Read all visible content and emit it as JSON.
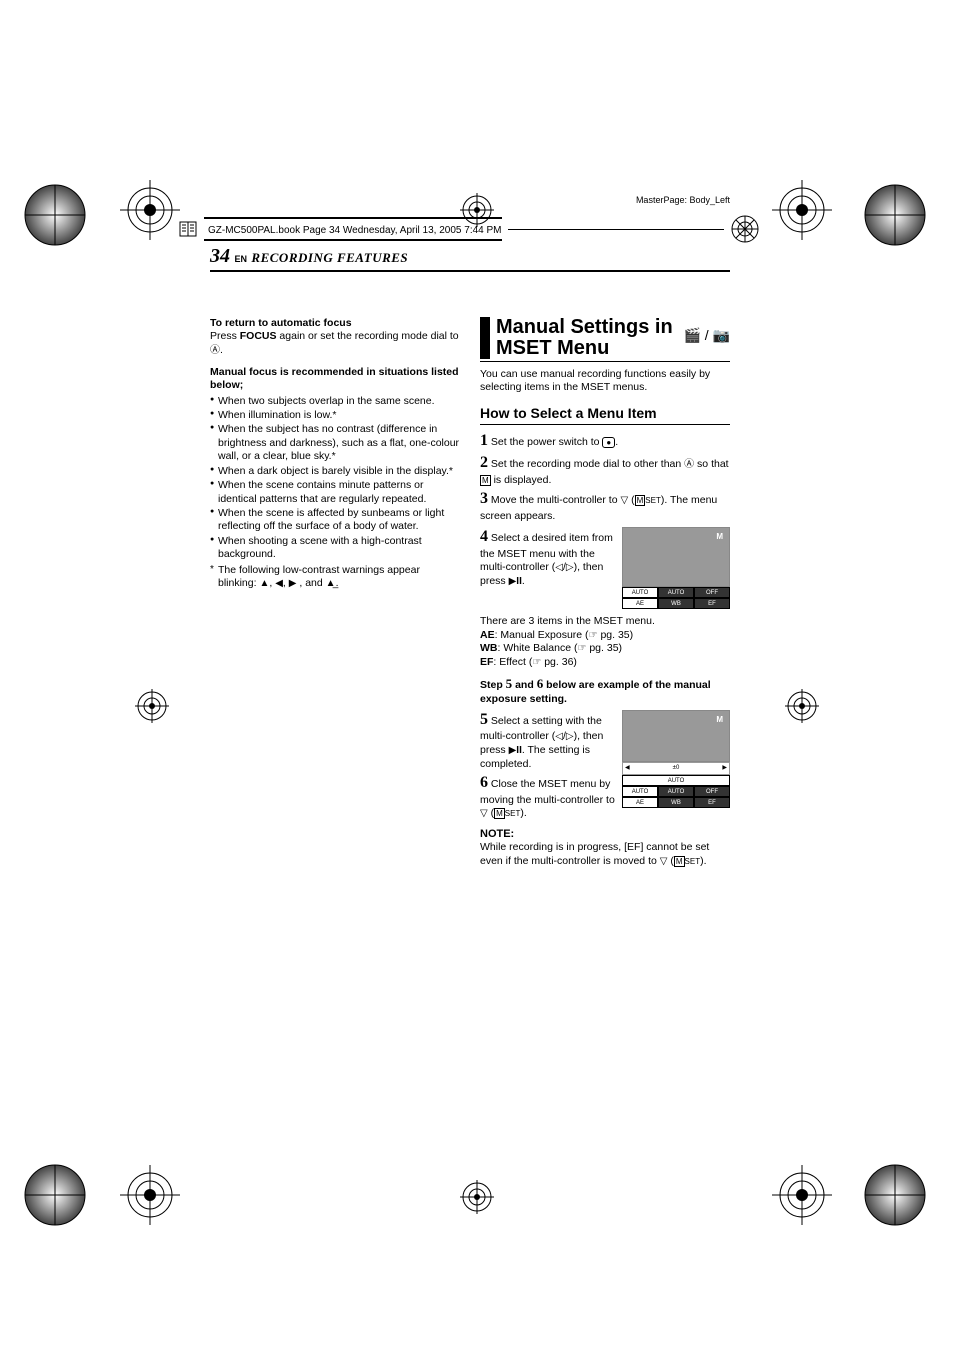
{
  "masterpage": "MasterPage: Body_Left",
  "book_ref": "GZ-MC500PAL.book  Page 34  Wednesday, April 13, 2005  7:44 PM",
  "page_number": "34",
  "en_label": "EN",
  "section_header": "RECORDING FEATURES",
  "left": {
    "return_hdr": "To return to automatic focus",
    "return_body_a": "Press ",
    "return_body_b": "FOCUS",
    "return_body_c": " again or set the recording mode dial to ",
    "return_body_d": ".",
    "rec_hdr": "Manual focus is recommended in situations listed below;",
    "bullets": [
      "When two subjects overlap in the same scene.",
      "When illumination is low.*",
      "When the subject has no contrast (difference in brightness and darkness), such as a flat, one-colour wall, or a clear, blue sky.*",
      "When a dark object is barely visible in the display.*",
      "When the scene contains minute patterns or identical patterns that are regularly repeated.",
      "When the scene is affected by sunbeams or light reflecting off the surface of a body of water.",
      "When shooting a scene with a high-contrast background."
    ],
    "star_note_a": "The following low-contrast warnings appear blinking: ",
    "star_note_b": ", and ",
    "star_note_c": "."
  },
  "right": {
    "title": "Manual Settings in MSET Menu",
    "intro": "You can use manual recording functions easily by selecting items in the MSET menus.",
    "howto": "How to Select a Menu Item",
    "step1": "Set the power switch to ",
    "step1_end": ".",
    "step2a": "Set the recording mode dial to other than ",
    "step2b": " so that ",
    "step2c": " is displayed.",
    "step3a": "Move the multi-controller to ",
    "step3b": " (",
    "step3c": "). The menu screen appears.",
    "step4": "Select a desired item from the MSET menu with the multi-controller (",
    "step4b": "), then press ",
    "step4c": ".",
    "items_intro": "There are 3 items in the MSET menu.",
    "ae_label": "AE",
    "ae_text": ": Manual Exposure (",
    "ae_pg": " pg. 35)",
    "wb_label": "WB",
    "wb_text": ": White Balance (",
    "wb_pg": " pg. 35)",
    "ef_label": "EF",
    "ef_text": ": Effect (",
    "ef_pg": " pg. 36)",
    "example_hdr_a": "Step ",
    "example_hdr_5": "5",
    "example_hdr_b": " and ",
    "example_hdr_6": "6",
    "example_hdr_c": " below are example of the manual exposure setting.",
    "step5a": "Select a setting with the multi-controller (",
    "step5b": "), then press ",
    "step5c": ". The setting is completed.",
    "step6a": "Close the MSET menu by moving the multi-controller to ",
    "step6b": " (",
    "step6c": ").",
    "note_hdr": "NOTE:",
    "note_body_a": "While recording is in progress, [EF] cannot be set even if the multi-controller is moved to ",
    "note_body_b": " (",
    "note_body_c": ").",
    "tabs_top": {
      "ae": "AUTO",
      "wb": "AUTO",
      "ef": "OFF"
    },
    "tabs_bottom": {
      "ae": "AE",
      "wb": "WB",
      "ef": "EF"
    },
    "sel_label": "±0",
    "sel_auto": "AUTO",
    "mset_label": "SET",
    "icons": {
      "video": "🎬",
      "camera": "📷",
      "slash": "/",
      "rec": "●"
    }
  }
}
